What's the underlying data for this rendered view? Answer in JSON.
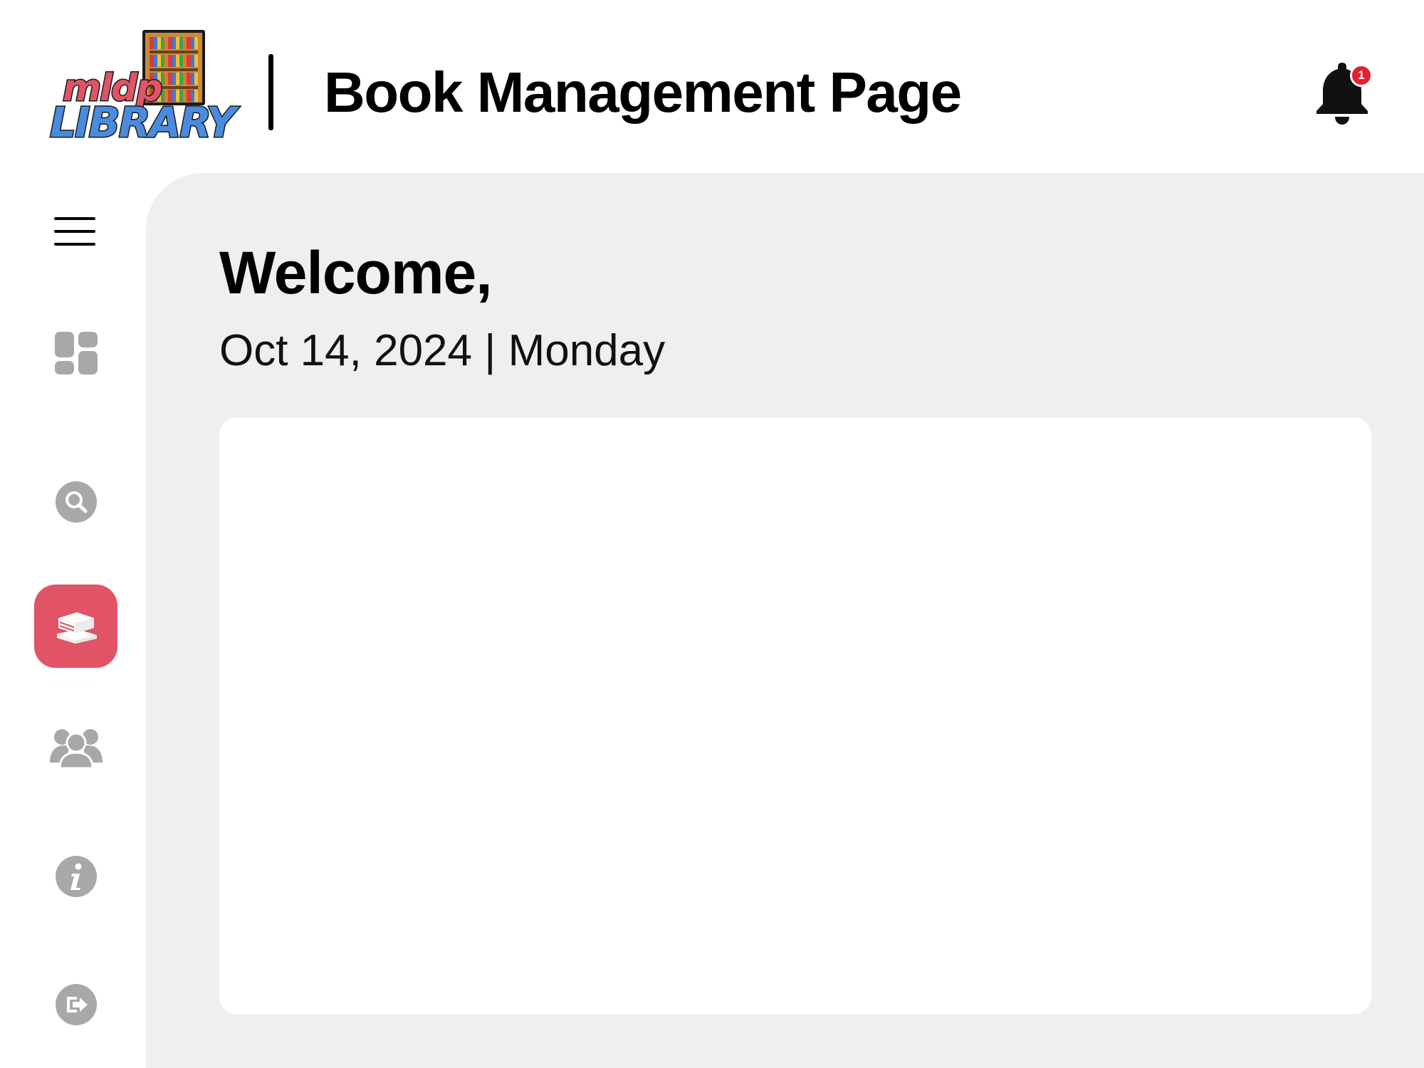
{
  "logo": {
    "line1": "mldp",
    "line2": "LIBRARY"
  },
  "header": {
    "title": "Book Management Page",
    "notification_count": "1"
  },
  "sidebar": {
    "items": [
      {
        "icon": "hamburger-menu-icon",
        "active": false
      },
      {
        "icon": "dashboard-icon",
        "active": false
      },
      {
        "icon": "search-icon",
        "active": false
      },
      {
        "icon": "books-icon",
        "active": true
      },
      {
        "icon": "users-icon",
        "active": false
      },
      {
        "icon": "info-icon",
        "active": false
      },
      {
        "icon": "logout-icon",
        "active": false
      }
    ]
  },
  "main": {
    "welcome": "Welcome,",
    "date_line": "Oct 14, 2024 | Monday"
  },
  "colors": {
    "accent": "#e05466",
    "icon_gray": "#a8a8a8",
    "content_bg": "#efefef",
    "badge": "#e3202f"
  }
}
